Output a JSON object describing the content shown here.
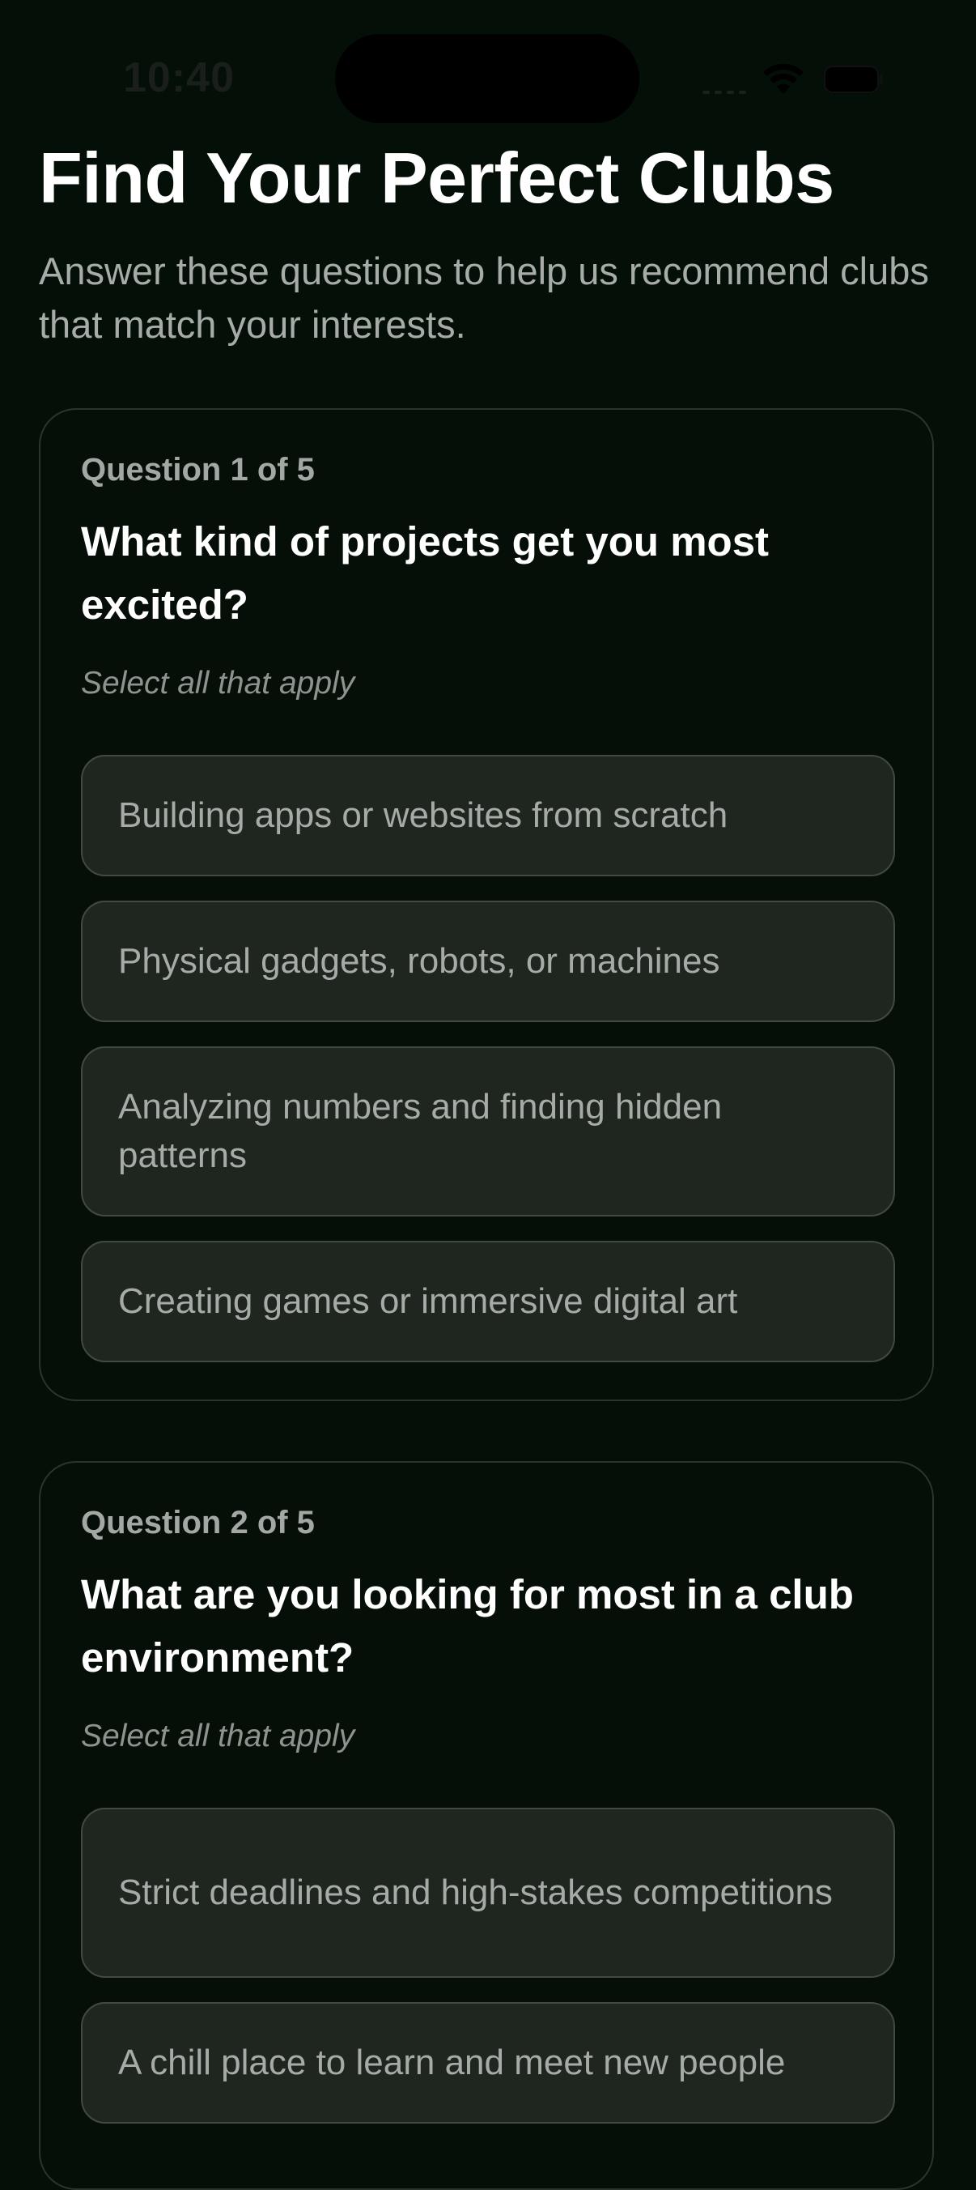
{
  "status_bar": {
    "time": "10:40",
    "icons": [
      "signal-icon",
      "wifi-icon",
      "battery-icon"
    ]
  },
  "header": {
    "title": "Find Your Perfect Clubs",
    "subtitle": "Answer these questions to help us recommend clubs that match your interests."
  },
  "questions": [
    {
      "counter": "Question 1 of 5",
      "text": "What kind of projects get you most excited?",
      "hint": "Select all that apply",
      "options": [
        "Building apps or websites from scratch",
        "Physical gadgets, robots, or machines",
        "Analyzing numbers and finding hidden patterns",
        "Creating games or immersive digital art"
      ]
    },
    {
      "counter": "Question 2 of 5",
      "text": "What are you looking for most in a club environment?",
      "hint": "Select all that apply",
      "options": [
        "Strict deadlines and high-stakes competitions",
        "A chill place to learn and meet new people"
      ]
    }
  ],
  "colors": {
    "background": "#030f07",
    "card_border": "#2c342e",
    "option_bg": "#1e261f",
    "option_border": "#3f4a41",
    "muted_text": "#a7aba8"
  }
}
